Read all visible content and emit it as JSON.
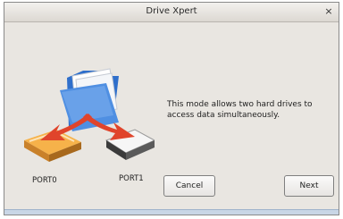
{
  "window": {
    "title": "Drive Xpert",
    "close_symbol": "×"
  },
  "illustration": {
    "icon": "folder-raid-mirroring-icon",
    "ports": [
      "PORT0",
      "PORT1"
    ]
  },
  "main": {
    "message": "This mode allows two hard drives to access data simultaneously."
  },
  "buttons": {
    "cancel": "Cancel",
    "next": "Next"
  },
  "colors": {
    "arrow_red": "#e0442b",
    "drive_orange": "#f2a63a",
    "folder_blue": "#3d7fd6",
    "window_bg": "#e9e6e1"
  }
}
